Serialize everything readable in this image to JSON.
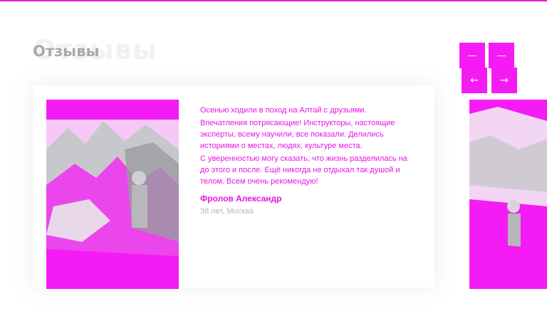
{
  "header": {
    "title": "Отзывы",
    "nav_prev_ghost": "—",
    "nav_next_ghost": "—",
    "nav_prev": "←",
    "nav_next": "→"
  },
  "review": {
    "paragraphs": [
      "Осенью ходили в поход на Алтай с друзьями.",
      "Впечатления потрясающие! Инструкторы, настоящие эксперты, всему научили, все показали. Делились историями о местах, людях, культуре места.",
      "С уверенностью могу сказать, что жизнь разделилась на до этого и после. Ещё никогда не отдыхал так душой и телом. Всем очень рекомендую!"
    ],
    "author": "Фролов Александр",
    "meta": "38 лет, Москва"
  },
  "colors": {
    "accent": "#f51bf5",
    "title_gray": "#a9a9ad"
  }
}
